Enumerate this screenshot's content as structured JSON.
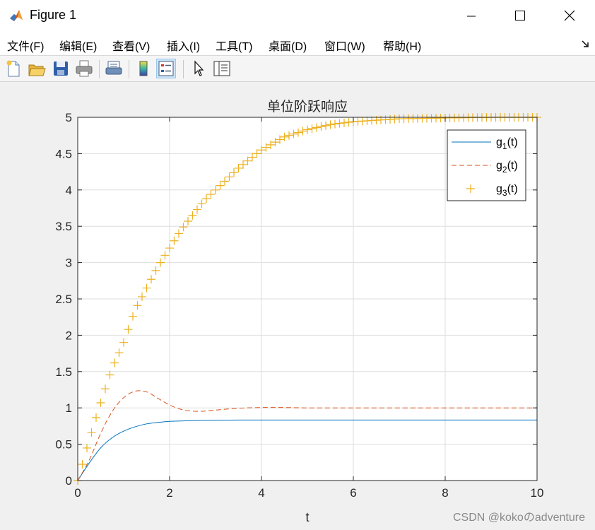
{
  "window": {
    "title": "Figure 1",
    "icon": "matlab-logo-icon"
  },
  "menu": [
    "文件(F)",
    "编辑(E)",
    "查看(V)",
    "插入(I)",
    "工具(T)",
    "桌面(D)",
    "窗口(W)",
    "帮助(H)"
  ],
  "toolbar": {
    "tools": [
      "new-figure-icon",
      "open-file-icon",
      "save-icon",
      "print-icon",
      "print-preview-icon",
      "colorbar-icon",
      "legend-icon",
      "edit-plot-pointer-icon",
      "property-inspector-icon"
    ],
    "active": "legend-icon"
  },
  "chart_data": {
    "type": "line",
    "title": "单位阶跃响应",
    "xlabel": "t",
    "ylabel": "",
    "xlim": [
      0,
      10
    ],
    "ylim": [
      0,
      5
    ],
    "xticks": [
      "0",
      "2",
      "4",
      "6",
      "8",
      "10"
    ],
    "yticks": [
      "0",
      "0.5",
      "1",
      "1.5",
      "2",
      "2.5",
      "3",
      "3.5",
      "4",
      "4.5",
      "5"
    ],
    "grid": true,
    "legend_position": "top-right",
    "x": [
      0,
      0.25,
      0.5,
      0.75,
      1.0,
      1.25,
      1.5,
      1.75,
      2.0,
      2.25,
      2.5,
      2.75,
      3.0,
      3.5,
      4.0,
      4.5,
      5.0,
      5.5,
      6.0,
      7.0,
      8.0,
      9.0,
      10.0
    ],
    "series": [
      {
        "name": "g1(t)",
        "sub": "1",
        "color": "#0072bd",
        "style": "solid",
        "values": [
          0,
          0.24,
          0.45,
          0.59,
          0.68,
          0.74,
          0.78,
          0.8,
          0.815,
          0.82,
          0.825,
          0.828,
          0.83,
          0.833,
          0.833,
          0.833,
          0.833,
          0.833,
          0.833,
          0.833,
          0.833,
          0.833,
          0.833
        ]
      },
      {
        "name": "g2(t)",
        "sub": "2",
        "color": "#d95319",
        "style": "dashed",
        "values": [
          0,
          0.28,
          0.65,
          0.95,
          1.14,
          1.23,
          1.22,
          1.13,
          1.04,
          0.98,
          0.955,
          0.955,
          0.97,
          0.995,
          1.005,
          1.005,
          1.0,
          1.0,
          1.0,
          1.0,
          1.0,
          1.0,
          1.0
        ]
      },
      {
        "name": "g3(t)",
        "sub": "3",
        "color": "#edb120",
        "style": "markers",
        "values": [
          0,
          0.56,
          1.07,
          1.55,
          1.9,
          2.35,
          2.65,
          2.95,
          3.2,
          3.45,
          3.65,
          3.85,
          4.0,
          4.3,
          4.55,
          4.73,
          4.83,
          4.9,
          4.94,
          4.98,
          4.99,
          5.0,
          5.0
        ]
      }
    ]
  },
  "watermark": "CSDN @kokoのadventure"
}
